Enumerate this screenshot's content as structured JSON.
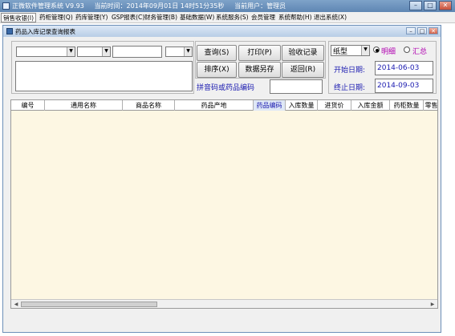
{
  "window": {
    "app_title": "正微软件管理系统 V9.93",
    "time_label": "当前时间：",
    "time_value": "2014年09月01日 14时51分35秒",
    "user_label": "当前用户：",
    "user_value": "管理员",
    "buttons": {
      "minimize": "–",
      "maximize": "□",
      "close": "✕"
    }
  },
  "menu": [
    "销售收银(I)",
    "药柜管理(Q)",
    "药库管理(Y)",
    "GSP报表(C)",
    "财务管理(B)",
    "基础数据(W)",
    "系统服务(S)",
    "会员管理",
    "系统帮助(H)",
    "退出系统(X)"
  ],
  "child": {
    "title": "药品入库记录查询报表",
    "buttons": {
      "minimize": "–",
      "restore": "□",
      "close": "✕"
    }
  },
  "filters": {
    "combo1": "",
    "combo2": "",
    "text1": "",
    "combo3": "",
    "memo": ""
  },
  "actions": {
    "query": "查询(S)",
    "print": "打印(P)",
    "acceptance": "验收记录",
    "sort": "排序(X)",
    "save_as": "数据另存",
    "back": "返回(R)"
  },
  "search": {
    "label": "拼音码或药品编码",
    "value": ""
  },
  "options": {
    "paper_type": "纸型",
    "detail_label": "明细",
    "summary_label": "汇总",
    "selected": "detail",
    "start_label": "开始日期:",
    "start_date": "2014-06-03",
    "end_label": "终止日期:",
    "end_date": "2014-09-03"
  },
  "table": {
    "columns": [
      "编号",
      "通用名称",
      "商品名称",
      "药品产地",
      "药品编码",
      "入库数量",
      "进货价",
      "入库金额",
      "药柜数量",
      "零售"
    ],
    "selected_column": 4,
    "rows": []
  },
  "colors": {
    "grid_background": "#fdf7e3",
    "accent_blue": "#1a1ab0",
    "title_bar": "#6b90bc"
  }
}
